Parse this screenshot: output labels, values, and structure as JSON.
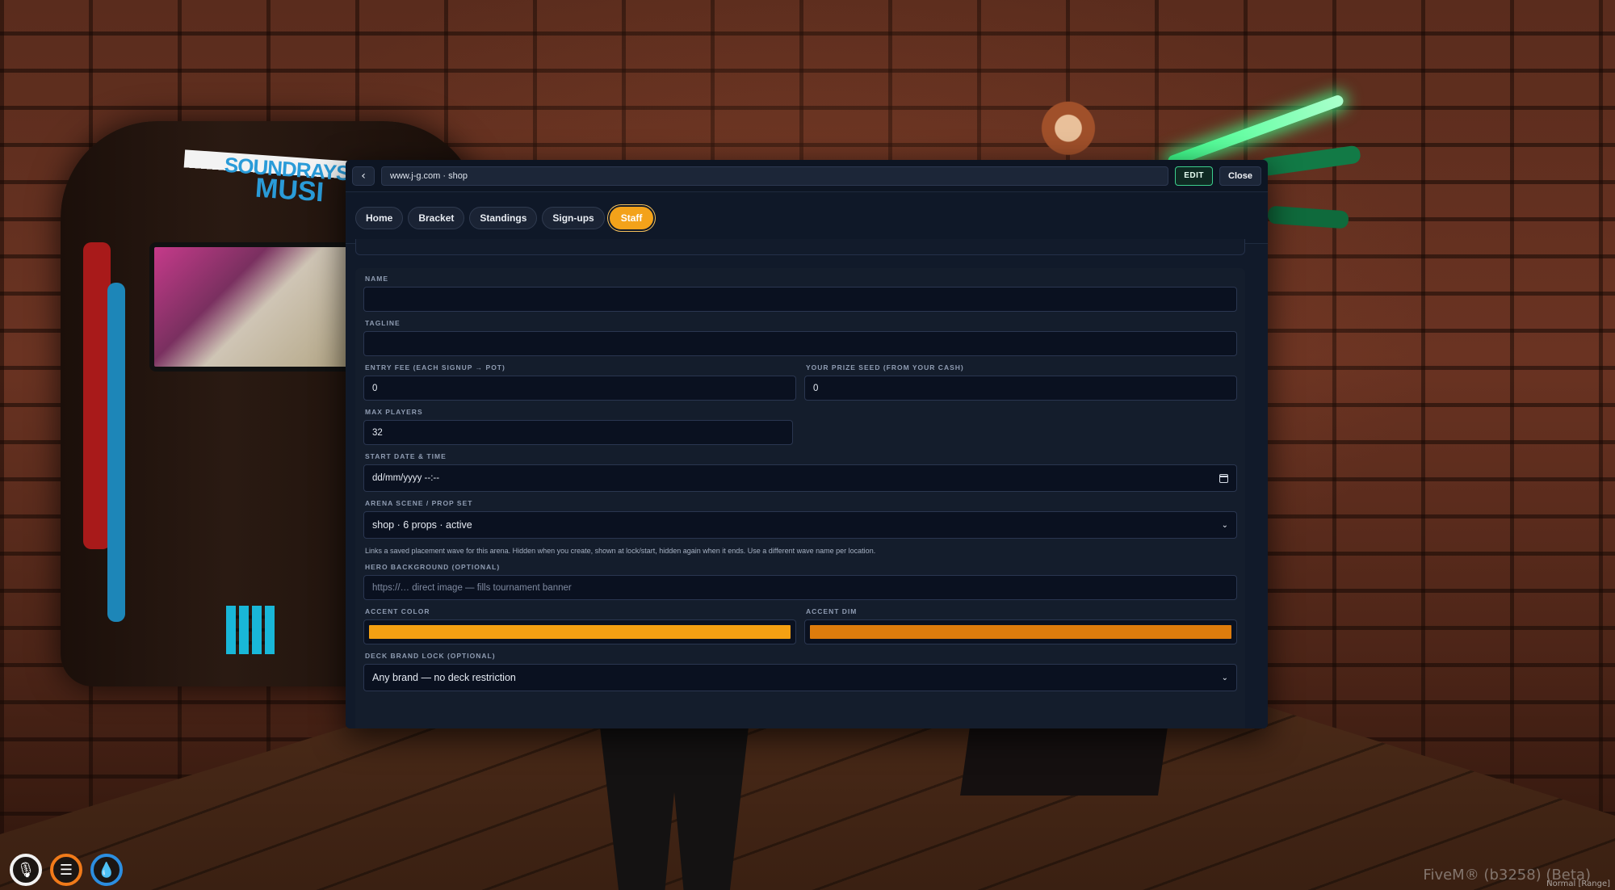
{
  "scene": {
    "sign_line1": "SOUNDRAYS",
    "sign_line2": "MUSI"
  },
  "browser": {
    "back_label": "‹",
    "url": "www.j-g.com · shop",
    "edit_label": "EDIT",
    "close_label": "Close"
  },
  "nav": {
    "tabs": [
      {
        "label": "Home"
      },
      {
        "label": "Bracket"
      },
      {
        "label": "Standings"
      },
      {
        "label": "Sign-ups"
      },
      {
        "label": "Staff"
      }
    ],
    "active": "Staff"
  },
  "form": {
    "name": {
      "label": "NAME",
      "value": ""
    },
    "tagline": {
      "label": "TAGLINE",
      "value": ""
    },
    "entry_fee": {
      "label": "ENTRY FEE (EACH SIGNUP → POT)",
      "value": "0"
    },
    "prize_seed": {
      "label": "YOUR PRIZE SEED (FROM YOUR CASH)",
      "value": "0"
    },
    "max_players": {
      "label": "MAX PLAYERS",
      "value": "32"
    },
    "start": {
      "label": "START DATE & TIME",
      "value": "dd/mm/yyyy --:--"
    },
    "arena": {
      "label": "ARENA SCENE / PROP SET",
      "value": "shop · 6 props · active"
    },
    "arena_hint": "Links a saved placement wave for this arena. Hidden when you create, shown at lock/start, hidden again when it ends. Use a different wave name per location.",
    "hero": {
      "label": "HERO BACKGROUND (OPTIONAL)",
      "placeholder": "https://… direct image — fills tournament banner"
    },
    "accent": {
      "label": "ACCENT COLOR",
      "color": "#f4a012"
    },
    "accent_dim": {
      "label": "ACCENT DIM",
      "color": "#de7c0c"
    },
    "deck_lock": {
      "label": "DECK BRAND LOCK (OPTIONAL)",
      "value": "Any brand — no deck restriction"
    }
  },
  "hud": {
    "voice_icon": "microphone-icon",
    "food_icon": "burger-icon",
    "water_icon": "water-drop-icon"
  },
  "watermark": {
    "text": "FiveM® (b3258) (Beta)",
    "sub": "Normal [Range]"
  }
}
